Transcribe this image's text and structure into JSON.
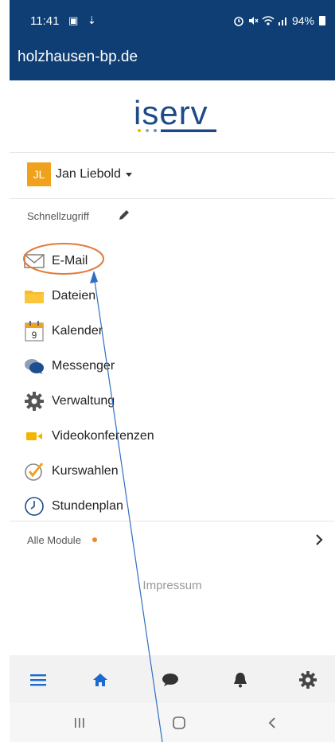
{
  "status": {
    "time": "11:41",
    "battery": "94%",
    "left_icons": "▣ ⇣"
  },
  "browser": {
    "url": "holzhausen-bp.de"
  },
  "logo": {
    "text": "iserv"
  },
  "user": {
    "initials": "JL",
    "name": "Jan Liebold"
  },
  "quick_access": {
    "label": "Schnellzugriff"
  },
  "menu": [
    {
      "label": "E-Mail",
      "icon": "mail-icon"
    },
    {
      "label": "Dateien",
      "icon": "folder-icon"
    },
    {
      "label": "Kalender",
      "icon": "calendar-icon",
      "day": "9"
    },
    {
      "label": "Messenger",
      "icon": "chat-bubbles-icon"
    },
    {
      "label": "Verwaltung",
      "icon": "gear-icon"
    },
    {
      "label": "Videokonferenzen",
      "icon": "video-camera-icon"
    },
    {
      "label": "Kurswahlen",
      "icon": "check-circle-icon"
    },
    {
      "label": "Stundenplan",
      "icon": "clock-icon"
    }
  ],
  "all_modules": {
    "label": "Alle Module"
  },
  "footer": {
    "impressum": "Impressum"
  },
  "bottom_nav": [
    "menu-icon",
    "home-icon",
    "chat-icon",
    "bell-icon",
    "settings-icon"
  ],
  "colors": {
    "header": "#0e3e73",
    "accent": "#1a6ad1",
    "avatar": "#f0a21f",
    "highlight": "#e07b39"
  }
}
